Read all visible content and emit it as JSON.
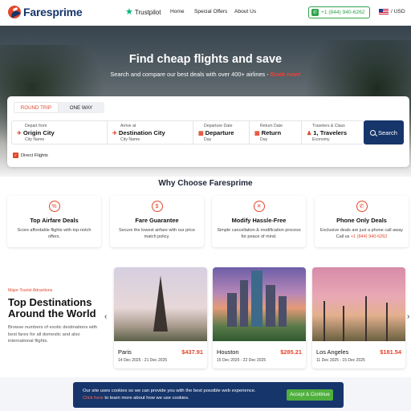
{
  "header": {
    "brand": "Faresprime",
    "trustpilot": "Trustpilot",
    "nav": [
      "Home",
      "Special Offers",
      "About Us"
    ],
    "phone": "+1 (844) 940-6262",
    "currency": "/ USD"
  },
  "hero": {
    "title": "Find cheap flights and save",
    "subtitle": "Search and compare our best deals with over 400+ airlines - ",
    "book_now": "Book now!"
  },
  "search": {
    "tabs": [
      "ROUND TRIP",
      "ONE WAY"
    ],
    "active_tab": "ROUND TRIP",
    "depart_from": {
      "label": "Depart from",
      "value": "Origin City",
      "sub": "City Name"
    },
    "arrive_at": {
      "label": "Arrive at",
      "value": "Destination City",
      "sub": "City Name"
    },
    "departure_date": {
      "label": "Departure Date",
      "value": "Departure",
      "sub": "Day"
    },
    "return_date": {
      "label": "Return Date",
      "value": "Return",
      "sub": "Day"
    },
    "travelers": {
      "label": "Travelers & Class",
      "value": "1, Travelers",
      "sub": "Economy"
    },
    "search_button": "Search",
    "direct_flights": {
      "label": "Direct Flights",
      "checked": true
    }
  },
  "why": {
    "title": "Why Choose Faresprime",
    "features": [
      {
        "icon": "percent-icon",
        "title": "Top Airfare Deals",
        "desc": "Score affordable flights with top-notch offers."
      },
      {
        "icon": "dollar-icon",
        "title": "Fare Guarantee",
        "desc": "Secure the lowest airfare with our price match policy."
      },
      {
        "icon": "close-circle-icon",
        "title": "Modify Hassle-Free",
        "desc": "Simple cancellation & modification process for peace of mind."
      },
      {
        "icon": "phone-icon",
        "title": "Phone Only Deals",
        "desc": "Exclusive deals are just a phone call away Call us ",
        "phone": "+1 (844) 940-6262"
      }
    ]
  },
  "destinations": {
    "kicker": "Major Tourist Attractions",
    "title": "Top Destinations Around the World",
    "desc": "Browse numbers of exotic destinations with best fares for all domestic and also international flights.",
    "cards": [
      {
        "city": "Paris",
        "price": "$437.91",
        "dates": "14 Dec 2025 - 21 Dec 2025"
      },
      {
        "city": "Houston",
        "price": "$285.21",
        "dates": "15 Dec 2025 - 22 Dec 2025"
      },
      {
        "city": "Los Angeles",
        "price": "$181.54",
        "dates": "11 Dec 2025 - 15 Dec 2025"
      }
    ]
  },
  "cookie": {
    "line1": "Our site uses cookies so we can provide you with the best possible web experience.",
    "link": "Click here",
    "line2": " to learn more about how we use cookies.",
    "button": "Accept & Continue"
  },
  "colors": {
    "brand_navy": "#16356b",
    "accent": "#e2472b",
    "green": "#4fb03e"
  }
}
